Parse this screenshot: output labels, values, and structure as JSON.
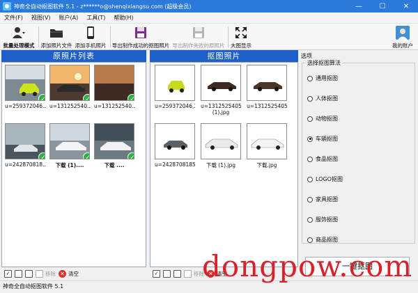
{
  "titlebar": {
    "title": "神奇全自动抠图软件 5.1 - z******o@shenqixiangsu.com (超级会员)",
    "minimize": "—",
    "maximize": "☐",
    "close": "✕"
  },
  "menu": [
    "文件(F)",
    "视图(V)",
    "账户(A)",
    "工具(T)",
    "帮助(H)"
  ],
  "toolbar": {
    "batch_mode": "批量处理模式",
    "add_file": "添加照片文件",
    "add_phone": "添加手机照片",
    "export_success": "导出制作成功的抠图照片",
    "export_failed": "导出制作失败的原照片",
    "large_view": "大图显示",
    "my_account": "我的账户"
  },
  "left_panel": {
    "header": "原照片列表",
    "items": [
      {
        "caption": "u=259372046...",
        "checked": true
      },
      {
        "caption": "u=131252540...",
        "checked": true
      },
      {
        "caption": "u=131252540...",
        "checked": true
      },
      {
        "caption": "u=242870818...",
        "checked": true
      },
      {
        "caption": "下载 (1)....",
        "checked": true
      },
      {
        "caption": "下载 ....",
        "checked": true
      }
    ],
    "bottom": {
      "remove": "移除",
      "clear": "清空"
    }
  },
  "middle_panel": {
    "header": "抠图照片",
    "items": [
      {
        "caption": "u=259372046,3..."
      },
      {
        "caption": "u=1312525405...",
        "caption2": "(1).jpg"
      },
      {
        "caption": "u=1312525405..."
      },
      {
        "caption": "u=2428708185..."
      },
      {
        "caption": "下载 (1).jpg"
      },
      {
        "caption": "下载.jpg"
      }
    ],
    "bottom": {
      "remove": "移除",
      "clear": "清空"
    }
  },
  "options": {
    "header": "选项",
    "group_label": "选择抠图算法",
    "algorithms": [
      "通用抠图",
      "人体抠图",
      "动物抠图",
      "车辆抠图",
      "食品抠图",
      "LOGO抠图",
      "家具抠图",
      "服饰抠图",
      "商品抠图"
    ],
    "selected": "车辆抠图",
    "action_button": "一键抠图"
  },
  "statusbar": {
    "text": "神奇全自动抠图软件 5.1"
  },
  "watermark": "dongpow.com",
  "colors": {
    "accent": "#1f60c8",
    "titlebar": "#2b79d8",
    "check": "#2fb041",
    "watermark": "#d8222b"
  }
}
